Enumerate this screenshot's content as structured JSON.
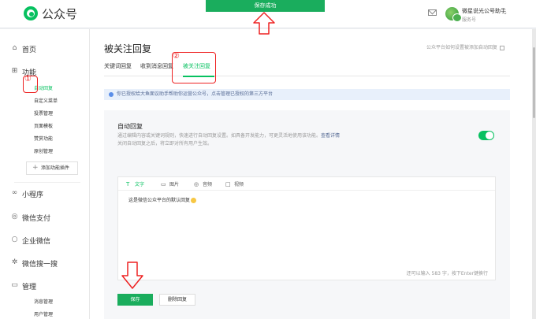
{
  "header": {
    "logo_text": "公众号",
    "toast": "保存成功",
    "account_name": "微星说光公号助手",
    "account_type": "服务号",
    "caret": "⌄"
  },
  "sidebar": {
    "home": "首页",
    "function": "功能",
    "function_items": [
      "自动回复",
      "自定义菜单",
      "投票管理",
      "页面模板",
      "赞赏功能",
      "原创管理"
    ],
    "add_plugin": "添加功能插件",
    "mini_program": "小程序",
    "wechat_pay": "微信支付",
    "enterprise_wechat": "企业微信",
    "wechat_search": "微信搜一搜",
    "manage": "管理",
    "manage_items": [
      "消息管理",
      "用户管理"
    ]
  },
  "main": {
    "title": "被关注回复",
    "help_link": "公众平台如何设置被添加自动回复",
    "tabs": [
      "关键词回复",
      "收到消息回复",
      "被关注回复"
    ],
    "notice": "你已授权给大鱼面议助手帮助你运营公众号，点击管理已授权的第三方平台",
    "card_title": "自动回复",
    "card_desc_line1": "通过编辑内容或关键词规则，快速进行自动回复设置。如具备开发能力，可更灵活地使用该功能。",
    "card_desc_link": "查看详情",
    "card_desc_line2": "关闭自动回复之后，将立即对所有用户生效。",
    "editor_tabs": [
      "文字",
      "图片",
      "音频",
      "视频"
    ],
    "editor_content": "这是微信公众平台的默认回复",
    "char_count": "还可以输入 583 字，按下Enter键换行",
    "save_button": "保存",
    "delete_button": "删除回复"
  },
  "annotations": [
    "①",
    "②"
  ],
  "colors": {
    "accent": "#07c160",
    "toast": "#1aad5d",
    "annotation": "#ee2222"
  }
}
